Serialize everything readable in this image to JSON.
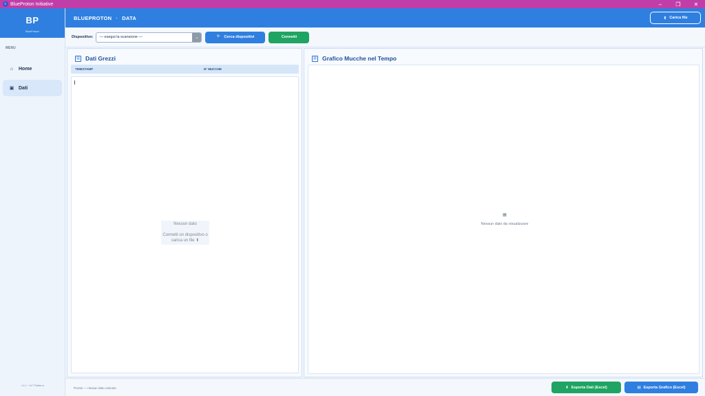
{
  "window": {
    "title": "BlueProton Initiative",
    "minimize_glyph": "–",
    "maximize_glyph": "❐",
    "close_glyph": "✕"
  },
  "sidebar": {
    "logo": "BP",
    "logo_sub": "BlueProton",
    "menu_label": "MENU",
    "items": [
      {
        "label": "Home",
        "icon": "home-icon",
        "glyph": "⌂",
        "active": false
      },
      {
        "label": "Dati",
        "icon": "database-icon",
        "glyph": "▣",
        "active": true
      }
    ],
    "version": "v1.0 · IoT Platform"
  },
  "header": {
    "crumb_root": "BLUEPROTON",
    "crumb_separator": "·",
    "crumb_page": "DATA",
    "upload_label": "Carica file",
    "upload_icon": "⬆"
  },
  "toolbar": {
    "device_label": "Dispositivo:",
    "device_selected": "— esegui la scansione —",
    "select_arrow": "⌄",
    "scan_label": "Cerca dispositivi",
    "scan_icon": "🔍",
    "connect_label": "Connetti"
  },
  "raw_panel": {
    "title": "Dati Grezzi",
    "col_timestamp": "TIMESTAMP",
    "col_cows": "N° MUCCHE",
    "empty_title": "Nessun dato",
    "empty_hint": "Connetti un dispositivo o carica un file ⬆"
  },
  "chart_panel": {
    "title": "Grafico Mucche nel Tempo",
    "empty_icon": "▦",
    "empty_text": "Nessun dato da visualizzare"
  },
  "status": {
    "text": "Pronto — nessun dato caricato",
    "export_data_label": "Esporta Dati (Excel)",
    "export_data_icon": "⬇",
    "export_chart_label": "Esporta Grafico (Excel)",
    "export_chart_icon": "▤"
  },
  "colors": {
    "primary": "#2f7fe0",
    "success": "#1fa463",
    "titlebar": "#c13ea9"
  }
}
